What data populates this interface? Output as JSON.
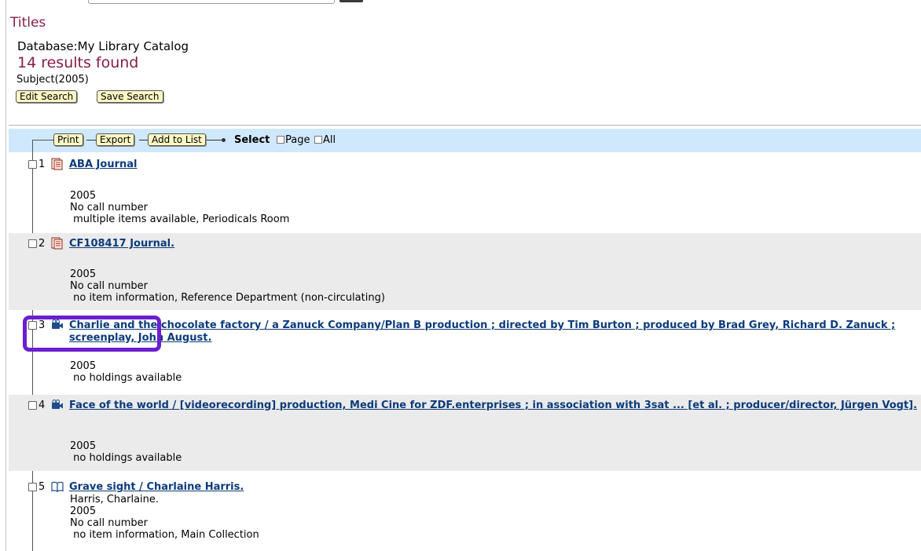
{
  "page": {
    "title": "Titles",
    "database_label": "Database:",
    "database_name": "My Library Catalog",
    "results": "14 results found",
    "subject": "Subject(2005)",
    "edit_search": "Edit Search",
    "save_search": "Save Search"
  },
  "toolbar": {
    "print": "Print",
    "export": "Export",
    "add_to_list": "Add to List",
    "select_label": "Select",
    "page_label": "Page",
    "all_label": "All"
  },
  "records": [
    {
      "num": "1",
      "icon": "journal-icon",
      "title": "ABA Journal",
      "lines": [
        "2005",
        "No call number",
        " multiple items available, Periodicals Room"
      ]
    },
    {
      "num": "2",
      "icon": "journal-icon",
      "title": "CF108417 Journal.",
      "lines": [
        "2005",
        "No call number",
        " no item information, Reference Department (non-circulating)"
      ]
    },
    {
      "num": "3",
      "icon": "video-camera-icon",
      "title": "Charlie and the chocolate factory / a Zanuck Company/Plan B production ; directed by Tim Burton ; produced by Brad Grey, Richard D. Zanuck ; screenplay, John August.",
      "lines": [
        "2005",
        " no holdings available"
      ]
    },
    {
      "num": "4",
      "icon": "video-camera-icon",
      "title": "Face of the world / [videorecording] production, Medi Cine for ZDF.enterprises ; in association with 3sat ... [et al. ; producer/director, Jürgen Vogt].",
      "lines": [
        "2005",
        " no holdings available"
      ]
    },
    {
      "num": "5",
      "icon": "book-icon",
      "title": "Grave sight / Charlaine Harris.",
      "lines": [
        "Harris, Charlaine.",
        "2005",
        "No call number",
        " no item information, Main Collection"
      ]
    }
  ],
  "colors": {
    "title_maroon": "#861e47",
    "link_blue": "#0c3b7a",
    "toolbar_bg": "#d0e8fb",
    "button_bg": "#fbf7c4",
    "highlight": "#6a1fd0"
  }
}
